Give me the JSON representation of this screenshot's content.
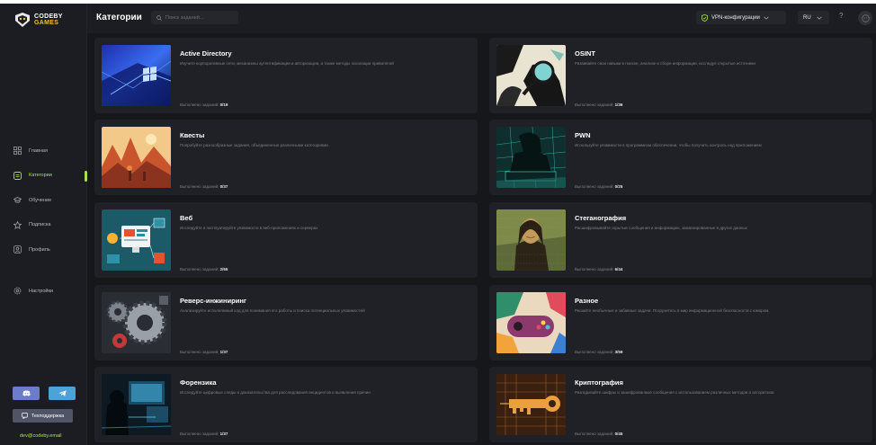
{
  "brand": {
    "line1": "CODEBY",
    "line2": "GAMES"
  },
  "header": {
    "title": "Категории",
    "search_placeholder": "Поиск заданий...",
    "vpn_label": "VPN-конфигурации",
    "lang": "RU",
    "help": "?"
  },
  "nav": {
    "items": [
      {
        "label": "Главная",
        "icon": "grid-icon"
      },
      {
        "label": "Категории",
        "icon": "categories-icon",
        "active": true
      },
      {
        "label": "Обучение",
        "icon": "learning-icon"
      },
      {
        "label": "Подписка",
        "icon": "star-icon"
      },
      {
        "label": "Профиль",
        "icon": "user-icon"
      }
    ],
    "settings": {
      "label": "Настройки",
      "icon": "gear-icon"
    }
  },
  "social": {
    "discord": "discord-icon",
    "telegram": "telegram-icon",
    "support_label": "Техподдержка"
  },
  "user_email": "dev@codeby.email",
  "progress_prefix": "Выполнено заданий:",
  "categories": [
    {
      "title": "Active Directory",
      "desc": "Изучите корпоративные сети, механизмы аутентификации и авторизации, а также методы эскалации привилегий",
      "progress": "0/19",
      "theme": "windows"
    },
    {
      "title": "OSINT",
      "desc": "Развивайте свои навыки в поиске, анализе и сборе информации, исследуя открытые источники",
      "progress": "1/36",
      "theme": "osint"
    },
    {
      "title": "Квесты",
      "desc": "Попробуйте разнообразные задания, объединенные различными категориями",
      "progress": "0/37",
      "theme": "quests"
    },
    {
      "title": "PWN",
      "desc": "Используйте уязвимости в программном обеспечении, чтобы получить контроль над приложением",
      "progress": "0/25",
      "theme": "pwn"
    },
    {
      "title": "Веб",
      "desc": "Исследуйте и эксплуатируйте уязвимости в веб-приложениях и серверах",
      "progress": "2/65",
      "theme": "web"
    },
    {
      "title": "Стеганография",
      "desc": "Расшифровывайте скрытые сообщения и информацию, замаскированные в других данных",
      "progress": "6/44",
      "theme": "stego"
    },
    {
      "title": "Реверс-инжиниринг",
      "desc": "Анализируйте исполняемый код для понимания его работы и поиска потенциальных уязвимостей",
      "progress": "1/37",
      "theme": "reverse"
    },
    {
      "title": "Разное",
      "desc": "Решайте необычные и забавные задачи. Погрузитесь в мир информационной безопасности с юмором.",
      "progress": "3/59",
      "theme": "misc"
    },
    {
      "title": "Форензика",
      "desc": "Исследуйте цифровые следы и доказательства для расследования инцидентов и выявления причин",
      "progress": "1/37",
      "theme": "forensics"
    },
    {
      "title": "Криптография",
      "desc": "Разгадывайте шифры и зашифрованные сообщения с использованием различных методов и алгоритмов",
      "progress": "0/45",
      "theme": "crypto"
    }
  ],
  "colors": {
    "accent": "#a8e34a",
    "bg": "#16171b",
    "card": "#202127",
    "sidebar": "#1c1d22"
  }
}
